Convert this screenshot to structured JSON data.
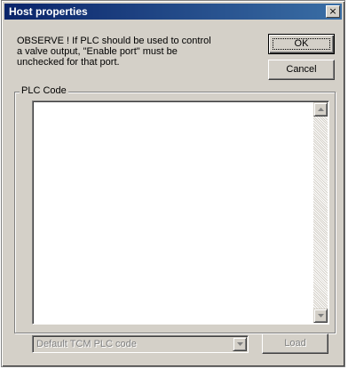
{
  "window": {
    "title": "Host properties",
    "close_glyph": "×"
  },
  "message": "OBSERVE ! If PLC should be used to control\na valve output, \"Enable port\" must be\nunchecked for that port.",
  "buttons": {
    "ok": "OK",
    "cancel": "Cancel",
    "load": "Load"
  },
  "plc_group": {
    "label": "PLC Code",
    "code": ""
  },
  "plc_select": {
    "selected": "Default TCM PLC code",
    "enabled": false
  },
  "icons": {
    "scroll_up": "scroll-up-arrow-icon",
    "scroll_down": "scroll-down-arrow-icon",
    "dropdown": "chevron-down-icon"
  }
}
